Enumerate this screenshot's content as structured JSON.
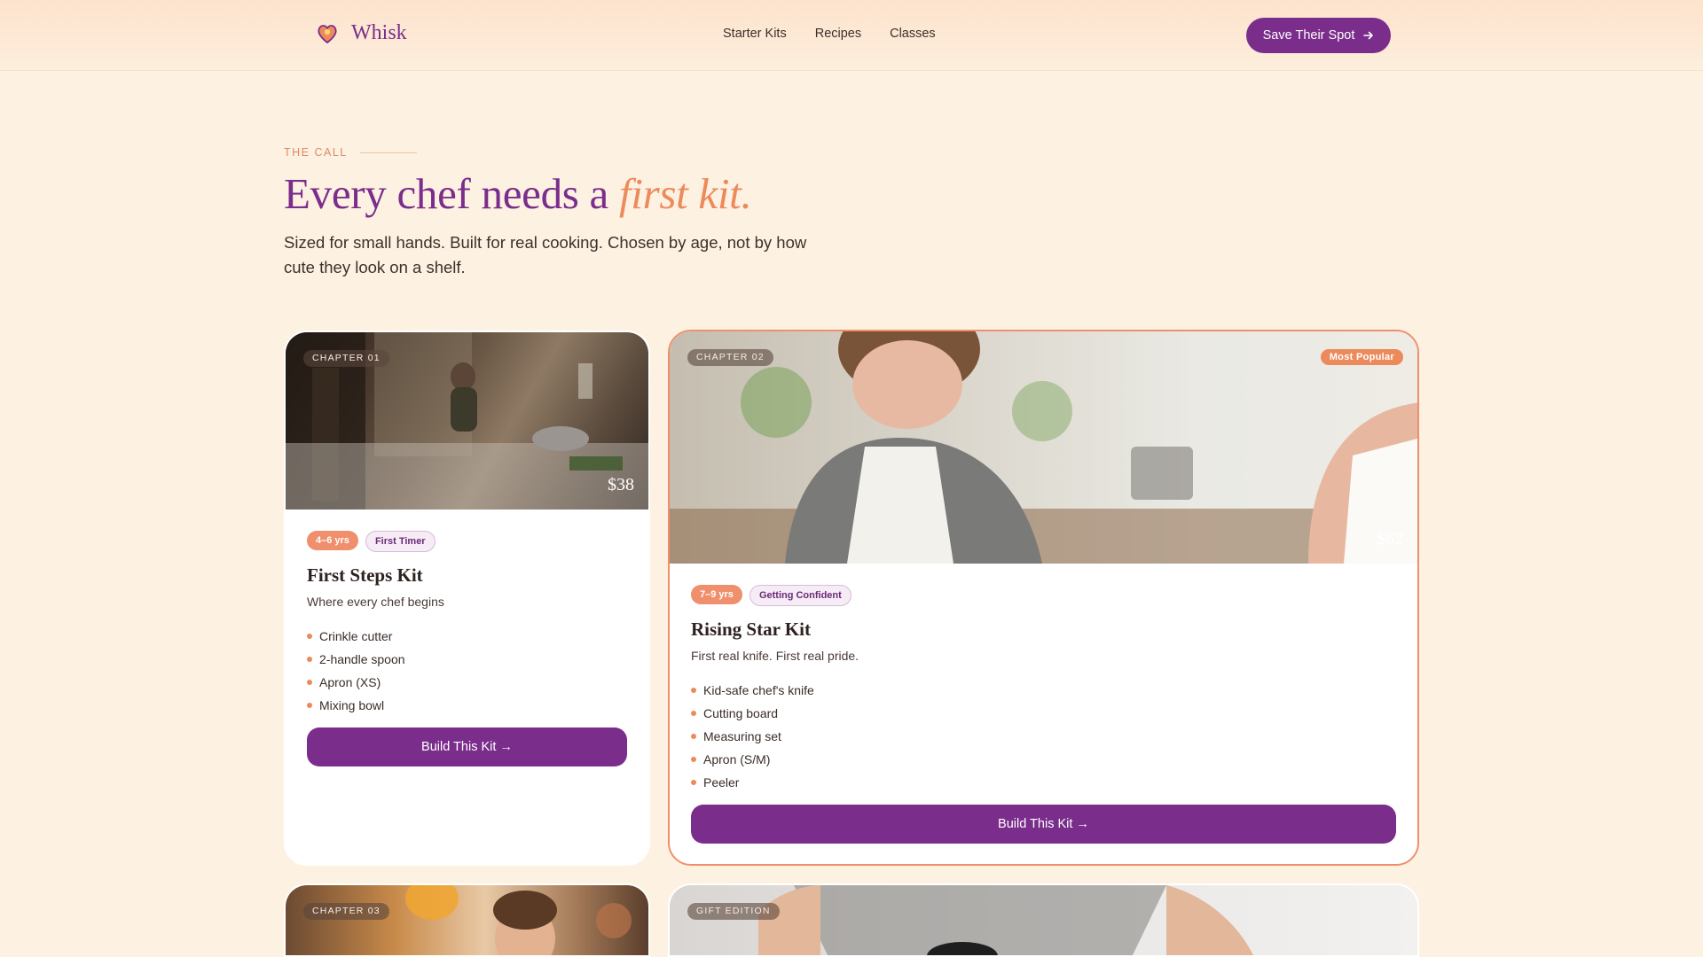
{
  "brand": {
    "name": "Whisk"
  },
  "nav": {
    "links": [
      "Starter Kits",
      "Recipes",
      "Classes"
    ],
    "cta_label": "Save Their Spot"
  },
  "hero": {
    "eyebrow": "THE CALL",
    "headline_main": "Every chef needs a",
    "headline_accent": "first kit.",
    "lede": "Sized for small hands. Built for real cooking. Chosen by age, not by how cute they look on a shelf."
  },
  "kits": [
    {
      "chapter": "CHAPTER 01",
      "price": "$38",
      "age": "4–6 yrs",
      "level": "First Timer",
      "name": "First Steps Kit",
      "subtitle": "Where every chef begins",
      "items": [
        "Crinkle cutter",
        "2-handle spoon",
        "Apron (XS)",
        "Mixing bowl"
      ],
      "button": "Build This Kit →"
    },
    {
      "chapter": "CHAPTER 02",
      "badge": "Most Popular",
      "price": "$62",
      "age": "7–9 yrs",
      "level": "Getting Confident",
      "name": "Rising Star Kit",
      "subtitle": "First real knife. First real pride.",
      "items": [
        "Kid-safe chef's knife",
        "Cutting board",
        "Measuring set",
        "Apron (S/M)",
        "Peeler"
      ],
      "button": "Build This Kit →"
    },
    {
      "chapter": "CHAPTER 03"
    },
    {
      "chapter": "GIFT EDITION"
    }
  ],
  "colors": {
    "brand_purple": "#7b2d8b",
    "accent_coral": "#ec8a5c",
    "page_bg": "#fdf1e2"
  }
}
